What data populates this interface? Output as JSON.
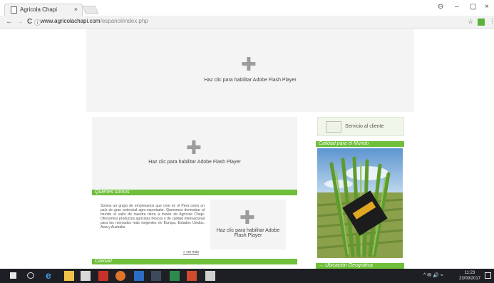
{
  "browser": {
    "tab_title": "Agricola Chapi",
    "tab_close": "×",
    "window_controls": {
      "account": "⊖",
      "minimize": "–",
      "restore": "▢",
      "close": "×"
    },
    "nav": {
      "back": "←",
      "forward": "→",
      "reload": "C"
    },
    "address": {
      "domain": "www.agricolachapi.com",
      "path": "/espanol/index.php"
    }
  },
  "page": {
    "flash_messages": {
      "top": "Haz clic para habilitar Adobe Flash Player",
      "middle": "Haz clic para habilitar Adobe Flash Player",
      "small": "Haz clic para habilitar Adobe Flash Player"
    },
    "sections": {
      "quienes": "Quiénes somos",
      "calidad": "Calidad",
      "calidad_mundo": "Calidad para el Mundo",
      "ubicacion": "→ Ubicación Geográfica"
    },
    "about_text": "Somos un grupo de empresarios que cree en el Perú como un país de gran potencial agro-exportador. Queremos demostrar al mundo el valor de nuestra tierra a través de Agrícola Chapi. Ofrecemos productos agrícolas frescos y de calidad internacional para los mercados más exigentes en Europa, Estados Unidos, Asia y Australia.",
    "ver_mas": "> ver más",
    "servicio_label": "Servicio al cliente"
  },
  "taskbar": {
    "tray_text": "^ ✉ 🔊 ⌁",
    "time": "11:23",
    "date": "23/09/2017"
  },
  "colors": {
    "accent_green": "#6fbf3a",
    "flash_bg": "#f4f4f4",
    "taskbar": "#1e1f24"
  }
}
